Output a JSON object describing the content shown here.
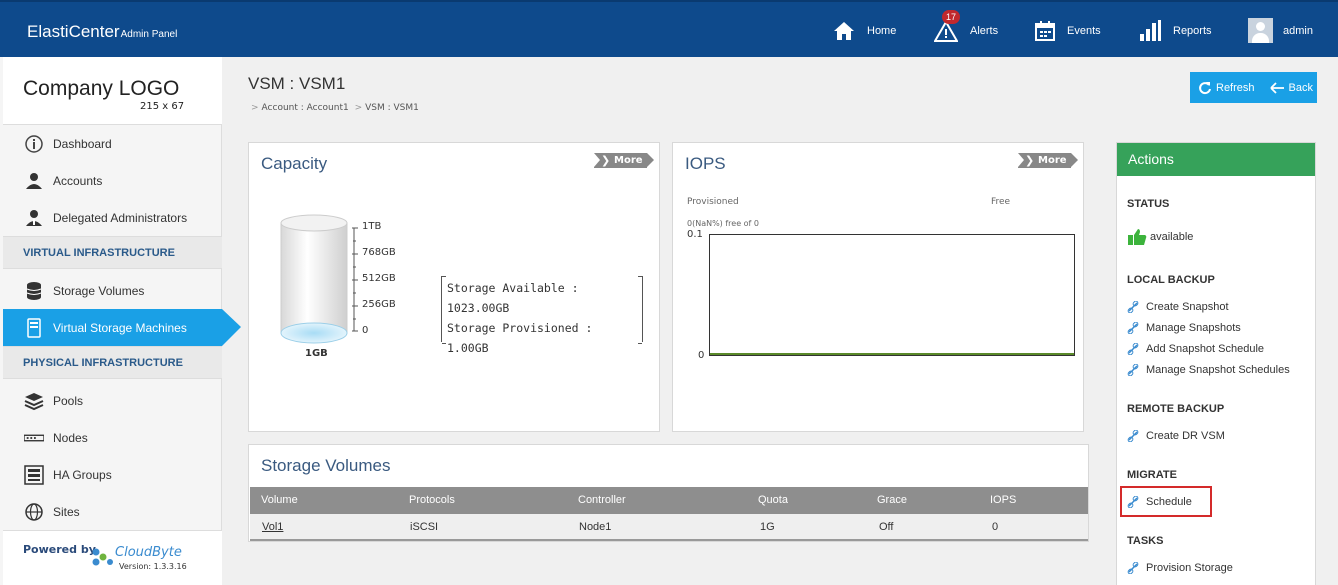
{
  "header": {
    "brand": "ElastiCenter",
    "brand_sub": "Admin Panel",
    "nav": [
      {
        "label": "Home",
        "icon": "home-icon"
      },
      {
        "label": "Alerts",
        "icon": "alert-icon",
        "badge": "17"
      },
      {
        "label": "Events",
        "icon": "calendar-icon"
      },
      {
        "label": "Reports",
        "icon": "bar-chart-icon"
      },
      {
        "label": "admin",
        "icon": "user-avatar"
      }
    ]
  },
  "sidebar": {
    "logo_text": "Company LOGO",
    "logo_size": "215 x 67",
    "items": [
      {
        "label": "Dashboard",
        "icon": "info-icon"
      },
      {
        "label": "Accounts",
        "icon": "user-icon"
      },
      {
        "label": "Delegated Administrators",
        "icon": "admin-icon"
      },
      {
        "label": "Storage Volumes",
        "icon": "database-icon"
      },
      {
        "label": "Virtual Storage Machines",
        "icon": "server-icon",
        "active": true
      },
      {
        "label": "Pools",
        "icon": "layers-icon"
      },
      {
        "label": "Nodes",
        "icon": "node-icon"
      },
      {
        "label": "HA Groups",
        "icon": "ha-group-icon"
      },
      {
        "label": "Sites",
        "icon": "globe-icon"
      }
    ],
    "section_virtual": "VIRTUAL INFRASTRUCTURE",
    "section_physical": "PHYSICAL INFRASTRUCTURE",
    "powered_by": "Powered by",
    "powered_logo": "CloudByte",
    "version": "Version: 1.3.3.16"
  },
  "main": {
    "title": "VSM : VSM1",
    "breadcrumb": [
      "Account : Account1",
      "VSM : VSM1"
    ],
    "refresh_label": "Refresh",
    "back_label": "Back"
  },
  "capacity": {
    "title": "Capacity",
    "more": "More",
    "scale": [
      "1TB",
      "768GB",
      "512GB",
      "256GB",
      "0"
    ],
    "used_label": "1GB",
    "available": "Storage Available : 1023.00GB",
    "provisioned": "Storage Provisioned : 1.00GB"
  },
  "iops": {
    "title": "IOPS",
    "more": "More",
    "provisioned_label": "Provisioned",
    "free_label": "Free",
    "free_text": "0(NaN%) free of 0",
    "ymax": "0.1",
    "ymin": "0"
  },
  "volumes": {
    "title": "Storage Volumes",
    "columns": [
      "Volume",
      "Protocols",
      "Controller",
      "Quota",
      "Grace",
      "IOPS"
    ],
    "rows": [
      [
        "Vol1",
        "iSCSI",
        "Node1",
        "1G",
        "Off",
        "0"
      ]
    ]
  },
  "actions": {
    "title": "Actions",
    "status_head": "STATUS",
    "status_value": "available",
    "local_backup_head": "LOCAL BACKUP",
    "local_backup": [
      "Create Snapshot",
      "Manage Snapshots",
      "Add Snapshot Schedule",
      "Manage Snapshot Schedules"
    ],
    "remote_backup_head": "REMOTE BACKUP",
    "remote_backup": [
      "Create DR VSM"
    ],
    "migrate_head": "MIGRATE",
    "migrate": [
      "Schedule"
    ],
    "tasks_head": "TASKS",
    "tasks": [
      "Provision Storage"
    ]
  },
  "colors": {
    "header_bg": "#0e4a8c",
    "accent_blue": "#1aa0e6",
    "actions_green": "#36a25a",
    "highlight_red": "#d42a2a"
  }
}
